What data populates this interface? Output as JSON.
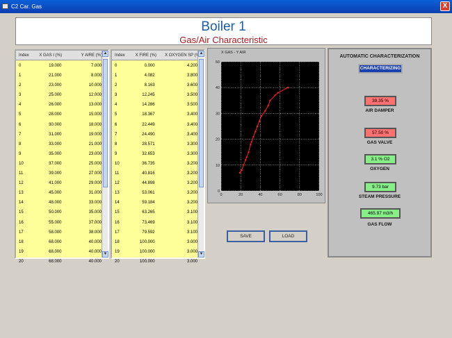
{
  "window": {
    "title": "C2 Car. Gas",
    "close_label": "X"
  },
  "header": {
    "title": "Boiler 1",
    "subtitle": "Gas/Air Characteristic"
  },
  "table1": {
    "columns": [
      "Index",
      "X GAS I (%)",
      "Y AIRE (%)"
    ],
    "rows": [
      [
        "0",
        "19.000",
        "7.000"
      ],
      [
        "1",
        "21.000",
        "8.000"
      ],
      [
        "2",
        "23.000",
        "10.000"
      ],
      [
        "3",
        "25.000",
        "12.000"
      ],
      [
        "4",
        "26.000",
        "13.000"
      ],
      [
        "5",
        "28.000",
        "15.000"
      ],
      [
        "6",
        "30.000",
        "18.000"
      ],
      [
        "7",
        "31.000",
        "19.000"
      ],
      [
        "8",
        "33.000",
        "21.000"
      ],
      [
        "9",
        "35.000",
        "23.000"
      ],
      [
        "10",
        "37.000",
        "25.000"
      ],
      [
        "11",
        "39.000",
        "27.000"
      ],
      [
        "12",
        "41.000",
        "29.000"
      ],
      [
        "13",
        "45.000",
        "31.000"
      ],
      [
        "14",
        "48.000",
        "33.000"
      ],
      [
        "15",
        "50.000",
        "35.000"
      ],
      [
        "16",
        "55.000",
        "37.000"
      ],
      [
        "17",
        "58.000",
        "38.000"
      ],
      [
        "18",
        "68.000",
        "40.000"
      ],
      [
        "19",
        "68.000",
        "40.000"
      ],
      [
        "20",
        "68.000",
        "40.000"
      ]
    ]
  },
  "table2": {
    "columns": [
      "Index",
      "X FIRE (%)",
      "X OXYGEN SP (%)"
    ],
    "rows": [
      [
        "0",
        "0.000",
        "4.200"
      ],
      [
        "1",
        "4.082",
        "3.800"
      ],
      [
        "2",
        "8.163",
        "3.600"
      ],
      [
        "3",
        "12.245",
        "3.500"
      ],
      [
        "4",
        "14.286",
        "3.500"
      ],
      [
        "5",
        "18.367",
        "3.400"
      ],
      [
        "6",
        "22.449",
        "3.400"
      ],
      [
        "7",
        "24.490",
        "3.400"
      ],
      [
        "8",
        "28.571",
        "3.300"
      ],
      [
        "9",
        "32.653",
        "3.300"
      ],
      [
        "10",
        "36.735",
        "3.200"
      ],
      [
        "11",
        "40.816",
        "3.200"
      ],
      [
        "12",
        "44.898",
        "3.200"
      ],
      [
        "13",
        "53.061",
        "3.200"
      ],
      [
        "14",
        "59.184",
        "3.200"
      ],
      [
        "15",
        "63.265",
        "3.100"
      ],
      [
        "16",
        "73.469",
        "3.100"
      ],
      [
        "17",
        "79.592",
        "3.100"
      ],
      [
        "18",
        "100.000",
        "3.000"
      ],
      [
        "19",
        "100.000",
        "3.000"
      ],
      [
        "20",
        "100.000",
        "3.000"
      ]
    ]
  },
  "buttons": {
    "save": "SAVE",
    "load": "LOAD"
  },
  "chart_data": {
    "type": "line",
    "title": "X GAS - Y AIR",
    "xlabel": "",
    "ylabel": "",
    "xlim": [
      0,
      100
    ],
    "ylim": [
      0,
      50
    ],
    "xticks": [
      "0",
      "20",
      "40",
      "60",
      "80",
      "100"
    ],
    "yticks": [
      "0",
      "10",
      "20",
      "30",
      "40",
      "50"
    ],
    "grid": true,
    "series": [
      {
        "color": "#ff2020",
        "x": [
          19,
          21,
          23,
          25,
          26,
          28,
          30,
          31,
          33,
          35,
          37,
          39,
          41,
          45,
          48,
          50,
          55,
          58,
          68,
          68,
          68
        ],
        "y": [
          7,
          8,
          10,
          12,
          13,
          15,
          18,
          19,
          21,
          23,
          25,
          27,
          29,
          31,
          33,
          35,
          37,
          38,
          40,
          40,
          40
        ]
      }
    ]
  },
  "auto_char": {
    "title": "AUTOMATIC CHARACTERIZATION",
    "status": "CHARACTERIZING",
    "indicators": [
      {
        "value": "39.35 %",
        "label": "AIR DAMPER",
        "color": "red"
      },
      {
        "value": "57.50 %",
        "label": "GAS VALVE",
        "color": "red"
      },
      {
        "value": "3.1 % O2",
        "label": "OXYGEN",
        "color": "green"
      },
      {
        "value": "9.73 bar",
        "label": "STEAM PRESSURE",
        "color": "green"
      },
      {
        "value": "465.97 m3/h",
        "label": "GAS FLOW",
        "color": "green"
      }
    ]
  }
}
